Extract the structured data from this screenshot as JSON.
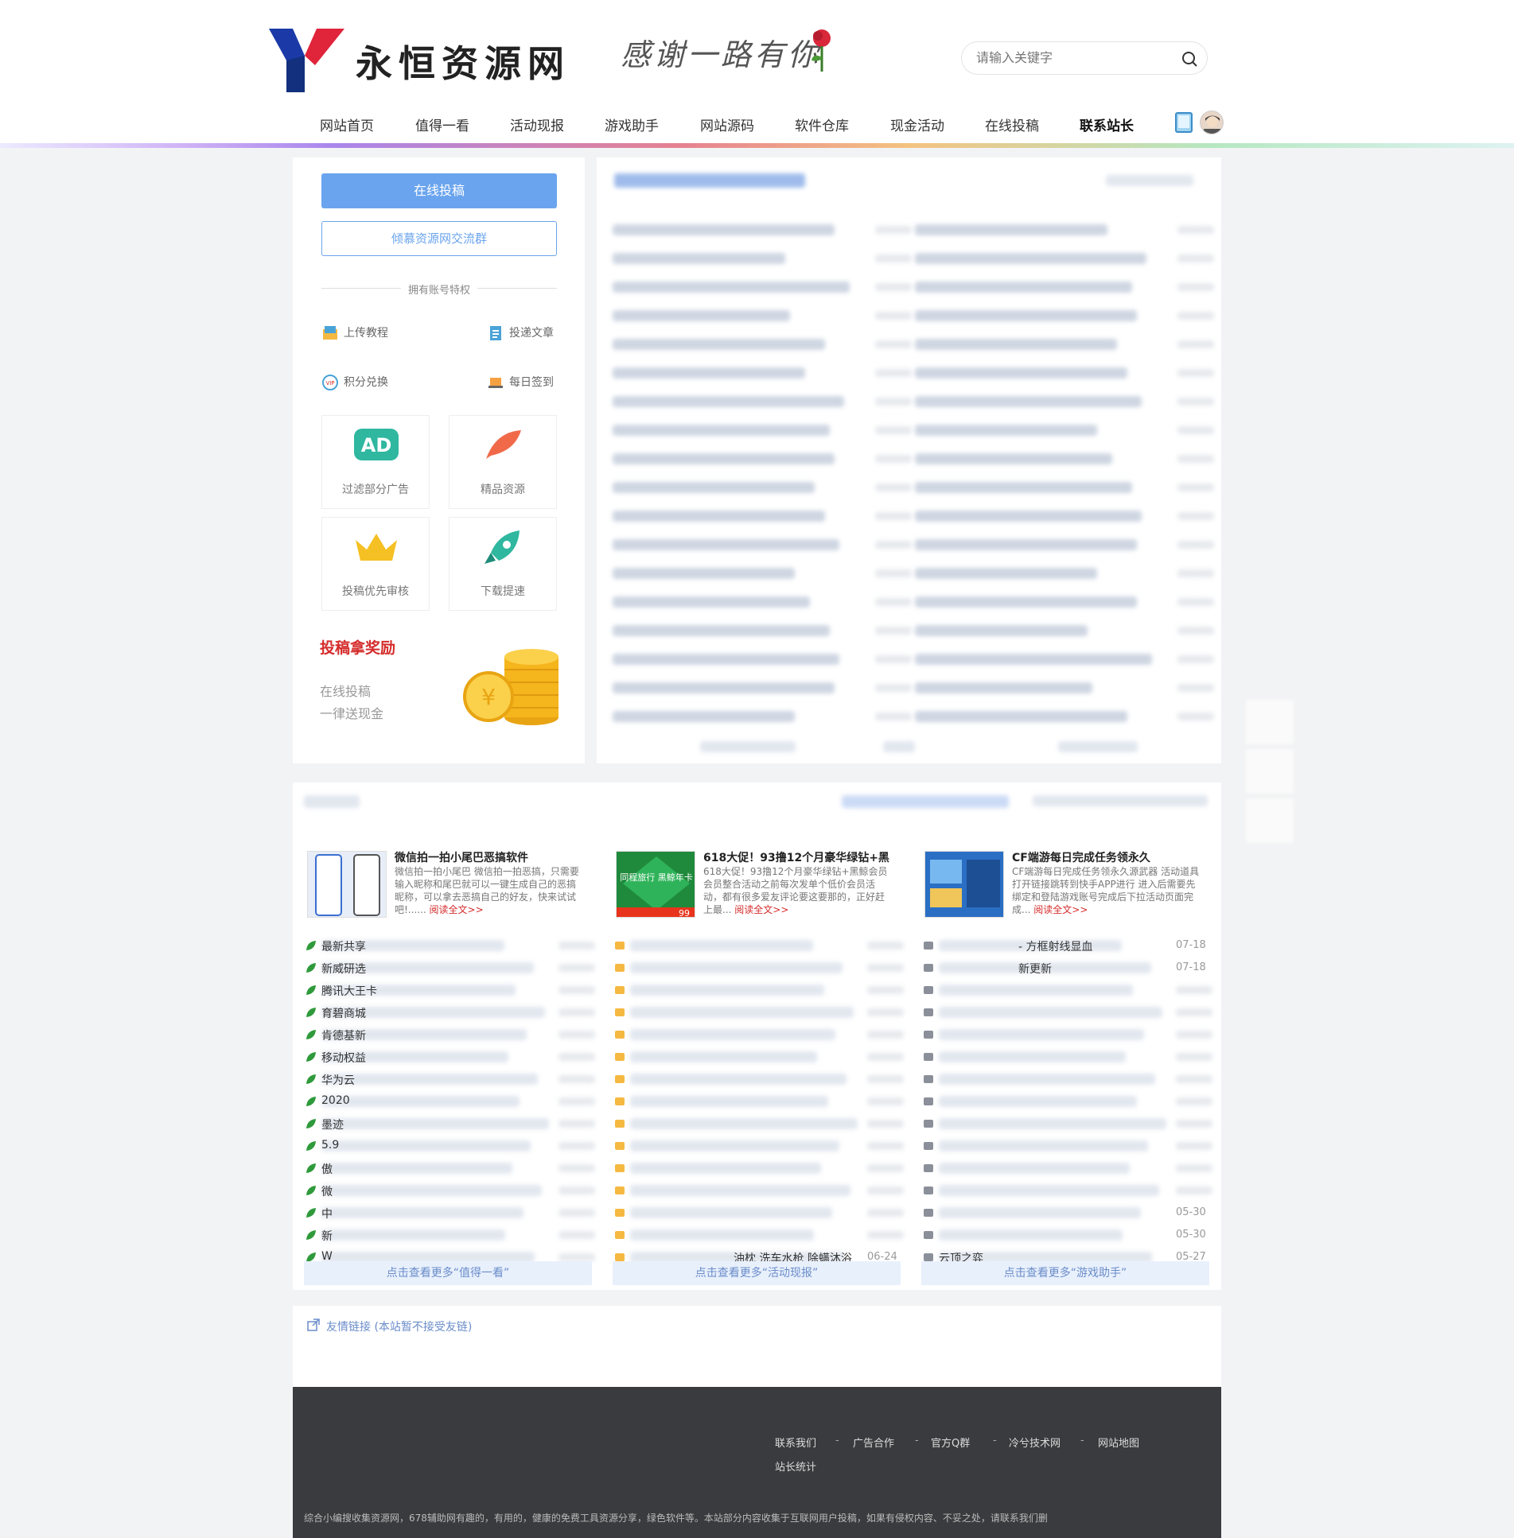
{
  "header": {
    "site_name": "永恒资源网",
    "slogan": "感谢一路有你",
    "search_placeholder": "请输入关键字"
  },
  "nav": {
    "items": [
      {
        "label": "网站首页"
      },
      {
        "label": "值得一看"
      },
      {
        "label": "活动现报"
      },
      {
        "label": "游戏助手"
      },
      {
        "label": "网站源码"
      },
      {
        "label": "软件仓库"
      },
      {
        "label": "现金活动"
      },
      {
        "label": "在线投稿"
      },
      {
        "label": "联系站长"
      }
    ]
  },
  "left_panel": {
    "primary_button": "在线投稿",
    "group_button": "倾慕资源网交流群",
    "privilege_heading": "拥有账号特权",
    "privileges": [
      {
        "label": "上传教程",
        "icon": "upload-icon"
      },
      {
        "label": "投递文章",
        "icon": "document-icon"
      },
      {
        "label": "积分兑换",
        "icon": "vip-icon"
      },
      {
        "label": "每日签到",
        "icon": "laptop-icon"
      }
    ],
    "tiles": [
      {
        "label": "过滤部分广告",
        "icon": "ad-icon"
      },
      {
        "label": "精品资源",
        "icon": "feather-icon"
      },
      {
        "label": "投稿优先审核",
        "icon": "crown-icon"
      },
      {
        "label": "下载提速",
        "icon": "rocket-icon"
      }
    ],
    "reward_title": "投稿拿奖励",
    "reward_lines": [
      "在线投稿",
      "一律送现金"
    ]
  },
  "cards": [
    {
      "title": "微信拍一拍小尾巴恶搞软件",
      "desc": "微信拍一拍小尾巴 微信拍一拍恶搞，只需要输入昵称和尾巴就可以一键生成自己的恶搞昵称，可以拿去恶搞自己的好友，快来试试吧!......",
      "readmore": "阅读全文>>"
    },
    {
      "title": "618大促！93撸12个月豪华绿钻+黑",
      "desc": "618大促！93撸12个月豪华绿钻+黑鲸会员 会员整合活动之前每次发单个低价会员活动，都有很多爱友评论要这要那的，正好赶上最...",
      "readmore": "阅读全文>>",
      "thumb_text": "同程旅行 黑鲸年卡",
      "thumb_badge": "99"
    },
    {
      "title": "CF端游每日完成任务领永久",
      "desc": "CF端游每日完成任务领永久源武器 活动道具打开链接跳转到快手APP进行 进入后需要先绑定和登陆游戏账号完成后下拉活动页面完成...",
      "readmore": "阅读全文>>"
    }
  ],
  "list_columns": [
    {
      "items": [
        "最新共享",
        "新威研选",
        "腾讯大王卡",
        "育碧商城",
        "肯德基新",
        "移动权益",
        "华为云",
        "2020",
        "墨迹",
        "5.9",
        "傲",
        "微",
        "中",
        "新",
        "W"
      ],
      "more": "点击查看更多“值得一看”"
    },
    {
      "items": [
        "",
        "",
        "",
        "",
        "",
        "",
        "",
        "",
        "",
        "",
        "",
        "",
        "",
        "",
        "油枕 洗车水枪 除螨沐浴"
      ],
      "dates": [
        "",
        "",
        "",
        "",
        "",
        "",
        "",
        "",
        "",
        "",
        "",
        "",
        "",
        "",
        "06-24"
      ],
      "more": "点击查看更多“活动现报”"
    },
    {
      "items": [
        "- 方框射线显血",
        "新更新",
        "",
        "",
        "",
        "",
        "",
        "",
        "",
        "",
        "",
        "",
        "",
        "",
        "云顶之弈"
      ],
      "dates": [
        "07-18",
        "07-18",
        "",
        "",
        "",
        "",
        "",
        "",
        "",
        "",
        "",
        "",
        "05-30",
        "05-30",
        "05-27"
      ],
      "more": "点击查看更多“游戏助手”"
    }
  ],
  "friends": {
    "title": "友情链接 (本站暂不接受友链)"
  },
  "footer": {
    "links": [
      "联系我们",
      "广告合作",
      "官方Q群",
      "冷兮技术网",
      "网站地图",
      "站长统计"
    ],
    "note": "综合小编搜收集资源网，678辅助网有趣的，有用的，健康的免费工具资源分享，绿色软件等。本站部分内容收集于互联网用户投稿，如果有侵权内容、不妥之处，请联系我们删"
  },
  "colors": {
    "accent_blue": "#6aa4ee",
    "reward_red": "#d52b2b",
    "footer_bg": "#3a3b3e"
  }
}
